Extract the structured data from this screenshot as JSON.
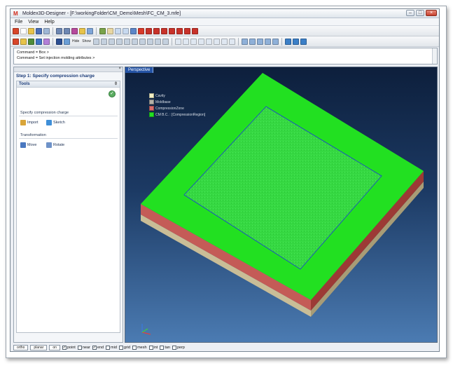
{
  "window": {
    "title": "Moldex3D-Designer - [F:\\workingFolder\\CM_Demo\\Mesh\\FC_CM_3.mfe]",
    "app_icon": "moldex-logo-icon"
  },
  "menu": [
    "File",
    "View",
    "Help"
  ],
  "toolbar": {
    "hide_label": "Hide",
    "show_label": "Show"
  },
  "command_area": {
    "lines": [
      "Command = Box >",
      "Command = Set injection molding attributes >"
    ]
  },
  "left_panel": {
    "step_title": "Step 1: Specify compression charge",
    "tools_header": "Tools",
    "section1": "Specify compression charge",
    "import_label": "Import",
    "sketch_label": "Sketch",
    "section2": "Transformation",
    "move_label": "Move",
    "rotate_label": "Rotate"
  },
  "viewport": {
    "tab_label": "Perspective",
    "legend": [
      {
        "label": "Cavity",
        "color": "#f3efc4"
      },
      {
        "label": "Moldbase",
        "color": "#b3b0a8"
      },
      {
        "label": "CompressionZone",
        "color": "#d76b6b"
      },
      {
        "label": "CM B.C. : [CompressionRegion]",
        "color": "#22e021"
      }
    ]
  },
  "status": {
    "ortho": "ortho",
    "planar": "planar",
    "on": "on",
    "checks": [
      {
        "label": "point",
        "checked": true
      },
      {
        "label": "near",
        "checked": false
      },
      {
        "label": "end",
        "checked": true
      },
      {
        "label": "mid",
        "checked": false
      },
      {
        "label": "grid",
        "checked": false
      },
      {
        "label": "mesh",
        "checked": false
      },
      {
        "label": "int",
        "checked": false
      },
      {
        "label": "tan",
        "checked": false
      },
      {
        "label": "perp",
        "checked": false
      }
    ]
  },
  "colors": {
    "charge_green": "#22e021",
    "compression_red": "#b74a4a",
    "base_tan": "#c9bd97"
  }
}
